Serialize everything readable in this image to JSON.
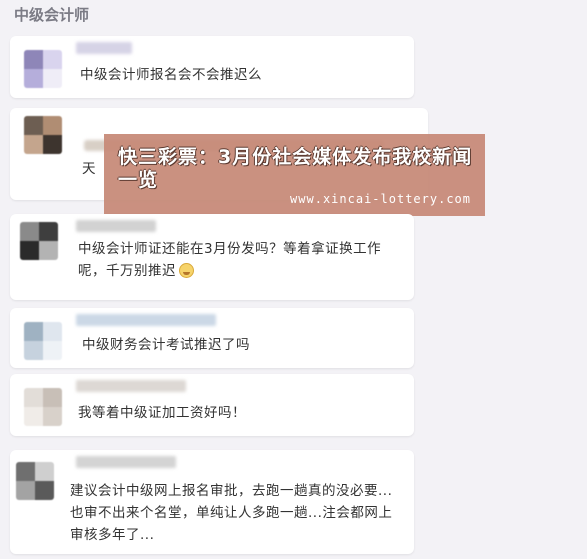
{
  "section": {
    "title": "中级会计师"
  },
  "banner": {
    "title": "快三彩票：3月份社会媒体发布我校新闻一览",
    "url": "www.xincai-lottery.com"
  },
  "comments": [
    {
      "text": "中级会计师报名会不会推迟么"
    },
    {
      "text": "天"
    },
    {
      "text": "中级会计师证还能在3月份发吗？等着拿证换工作呢，千万别推迟"
    },
    {
      "text": "中级财务会计考试推迟了吗"
    },
    {
      "text": "我等着中级证加工资好吗！"
    },
    {
      "text": "建议会计中级网上报名审批，去跑一趟真的没必要...也审不出来个名堂，单纯让人多跑一趟...注会都网上审核多年了..."
    }
  ],
  "icons": {
    "emoji": "crying-face-icon",
    "avatar": "pixelated-avatar-icon"
  },
  "colors": {
    "background": "#f3f2f6",
    "banner": "#c68976",
    "card": "#ffffff"
  }
}
